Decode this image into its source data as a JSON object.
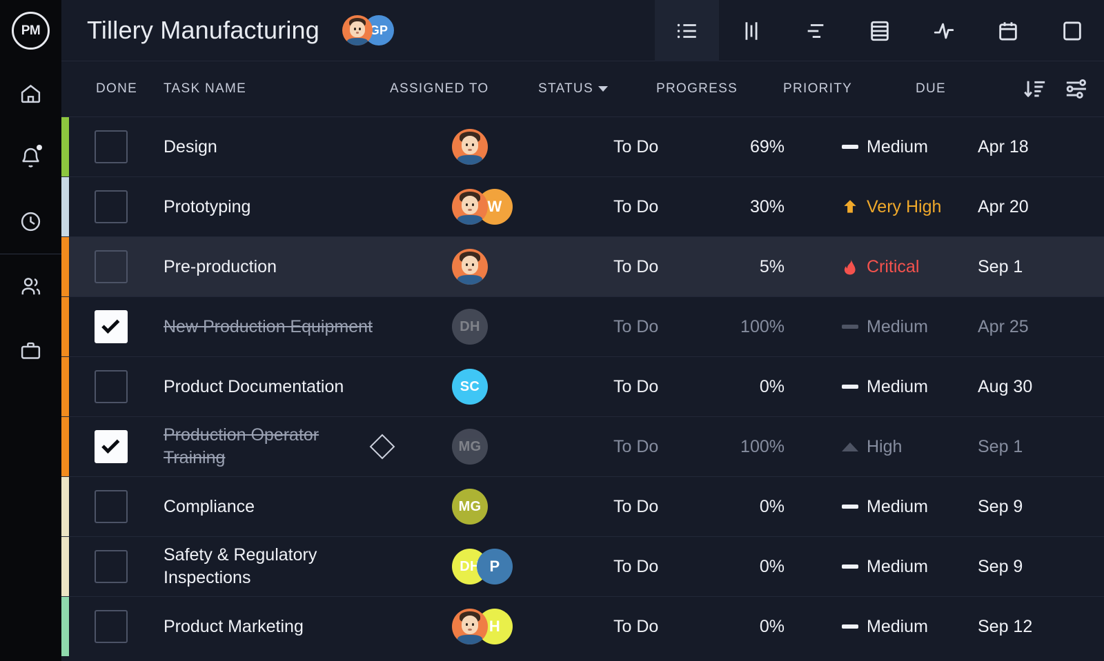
{
  "brand": {
    "logo_text": "PM"
  },
  "sidebar": {
    "items": [
      {
        "name": "home",
        "icon": "home-icon"
      },
      {
        "name": "notifications",
        "icon": "bell-icon",
        "badge": true
      },
      {
        "name": "timesheets",
        "icon": "clock-icon"
      },
      {
        "name": "people",
        "icon": "people-icon"
      },
      {
        "name": "portfolio",
        "icon": "briefcase-icon"
      }
    ]
  },
  "topbar": {
    "title": "Tillery Manufacturing",
    "avatars": [
      {
        "type": "photo",
        "label": ""
      },
      {
        "type": "initials",
        "label": "GP",
        "color": "#4a90d9"
      }
    ],
    "views": [
      {
        "name": "list-view",
        "icon": "list-icon",
        "active": true
      },
      {
        "name": "board-view",
        "icon": "board-icon",
        "active": false
      },
      {
        "name": "gantt-view",
        "icon": "gantt-icon",
        "active": false
      },
      {
        "name": "sheet-view",
        "icon": "sheet-icon",
        "active": false
      },
      {
        "name": "workload-view",
        "icon": "activity-icon",
        "active": false
      },
      {
        "name": "calendar-view",
        "icon": "calendar-icon",
        "active": false
      },
      {
        "name": "more-view",
        "icon": "panel-icon",
        "active": false
      }
    ]
  },
  "table": {
    "columns": {
      "done": "DONE",
      "task_name": "TASK NAME",
      "assigned_to": "ASSIGNED TO",
      "status": "STATUS",
      "progress": "PROGRESS",
      "priority": "PRIORITY",
      "due": "DUE"
    },
    "tools": [
      {
        "name": "sort-button",
        "icon": "sort-descending-icon"
      },
      {
        "name": "filter-button",
        "icon": "sliders-icon"
      }
    ],
    "rows": [
      {
        "done": false,
        "task_name": "Design",
        "milestone": false,
        "assignees": [
          {
            "type": "photo",
            "label": ""
          }
        ],
        "status": "To Do",
        "progress": "69%",
        "priority": "Medium",
        "priority_glyph": "bar",
        "priority_color": "#f0f2f7",
        "due": "Apr 18",
        "bar_color": "#8dc63f",
        "highlight": false,
        "completed_style": false
      },
      {
        "done": false,
        "task_name": "Prototyping",
        "milestone": false,
        "assignees": [
          {
            "type": "photo",
            "label": ""
          },
          {
            "type": "initials",
            "label": "W",
            "color": "#f2a33c"
          }
        ],
        "status": "To Do",
        "progress": "30%",
        "priority": "Very High",
        "priority_glyph": "arrow-up",
        "priority_color": "#f0a92b",
        "due": "Apr 20",
        "bar_color": "#c8d8e4",
        "highlight": false,
        "completed_style": false
      },
      {
        "done": false,
        "task_name": "Pre-production",
        "milestone": false,
        "assignees": [
          {
            "type": "photo",
            "label": ""
          }
        ],
        "status": "To Do",
        "progress": "5%",
        "priority": "Critical",
        "priority_glyph": "fire",
        "priority_color": "#f4524d",
        "due": "Sep 1",
        "bar_color": "#f28b1e",
        "highlight": true,
        "completed_style": false
      },
      {
        "done": true,
        "task_name": "New Production Equipment",
        "milestone": false,
        "assignees": [
          {
            "type": "initials",
            "label": "DH",
            "color": "#7b7f8c"
          }
        ],
        "status": "To Do",
        "progress": "100%",
        "priority": "Medium",
        "priority_glyph": "bar",
        "priority_color": "#868d9f",
        "due": "Apr 25",
        "bar_color": "#f28b1e",
        "highlight": false,
        "completed_style": true
      },
      {
        "done": false,
        "task_name": "Product Documentation",
        "milestone": false,
        "assignees": [
          {
            "type": "initials",
            "label": "SC",
            "color": "#3fc6f5"
          }
        ],
        "status": "To Do",
        "progress": "0%",
        "priority": "Medium",
        "priority_glyph": "bar",
        "priority_color": "#f0f2f7",
        "due": "Aug 30",
        "bar_color": "#f28b1e",
        "highlight": false,
        "completed_style": false
      },
      {
        "done": true,
        "task_name": "Production Operator Training",
        "milestone": true,
        "assignees": [
          {
            "type": "initials",
            "label": "MG",
            "color": "#7b7f8c"
          }
        ],
        "status": "To Do",
        "progress": "100%",
        "priority": "High",
        "priority_glyph": "triangle-up",
        "priority_color": "#868d9f",
        "due": "Sep 1",
        "bar_color": "#f28b1e",
        "highlight": false,
        "completed_style": true
      },
      {
        "done": false,
        "task_name": "Compliance",
        "milestone": false,
        "assignees": [
          {
            "type": "initials",
            "label": "MG",
            "color": "#adb334"
          }
        ],
        "status": "To Do",
        "progress": "0%",
        "priority": "Medium",
        "priority_glyph": "bar",
        "priority_color": "#f0f2f7",
        "due": "Sep 9",
        "bar_color": "#ece4c4",
        "highlight": false,
        "completed_style": false
      },
      {
        "done": false,
        "task_name": "Safety & Regulatory Inspections",
        "milestone": false,
        "assignees": [
          {
            "type": "initials",
            "label": "DH",
            "color": "#e9ef4a"
          },
          {
            "type": "initials",
            "label": "P",
            "color": "#3f7bb0"
          }
        ],
        "status": "To Do",
        "progress": "0%",
        "priority": "Medium",
        "priority_glyph": "bar",
        "priority_color": "#f0f2f7",
        "due": "Sep 9",
        "bar_color": "#ece4c4",
        "highlight": false,
        "completed_style": false
      },
      {
        "done": false,
        "task_name": "Product Marketing",
        "milestone": false,
        "assignees": [
          {
            "type": "photo",
            "label": ""
          },
          {
            "type": "initials",
            "label": "H",
            "color": "#e9ef4a"
          }
        ],
        "status": "To Do",
        "progress": "0%",
        "priority": "Medium",
        "priority_glyph": "bar",
        "priority_color": "#f0f2f7",
        "due": "Sep 12",
        "bar_color": "#8fd9ad",
        "highlight": false,
        "completed_style": false
      }
    ]
  }
}
